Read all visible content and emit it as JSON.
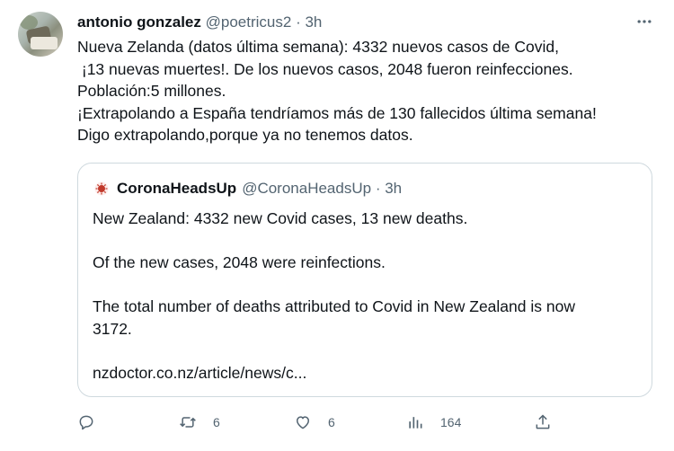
{
  "author": {
    "name": "antonio gonzalez",
    "handle": "@poetricus2",
    "separator": "·",
    "time": "3h"
  },
  "tweet_lines": [
    "Nueva Zelanda (datos última semana): 4332 nuevos casos de Covid,",
    " ¡13 nuevas muertes!. De los nuevos casos, 2048 fueron reinfecciones.",
    "Población:5 millones.",
    "¡Extrapolando a España tendríamos más de 130 fallecidos última semana!",
    "Digo extrapolando,porque ya no tenemos datos."
  ],
  "quote": {
    "name": "CoronaHeadsUp",
    "handle": "@CoronaHeadsUp",
    "separator": "·",
    "time": "3h",
    "line1": "New Zealand: 4332 new Covid cases, 13 new deaths.",
    "line2": "Of the new cases, 2048 were reinfections.",
    "line3a": "The total number of deaths attributed to Covid in New Zealand is now",
    "line3b": "3172.",
    "link": "nzdoctor.co.nz/article/news/c..."
  },
  "actions": {
    "reply_icon": "reply-icon",
    "retweet_icon": "retweet-icon",
    "retweet_count": "6",
    "like_icon": "heart-icon",
    "like_count": "6",
    "views_icon": "views-icon",
    "views_count": "164",
    "share_icon": "share-icon"
  },
  "colors": {
    "text": "#0f1419",
    "secondary": "#536471",
    "border": "#cfd9de",
    "quote_avatar": "#c0392b"
  }
}
